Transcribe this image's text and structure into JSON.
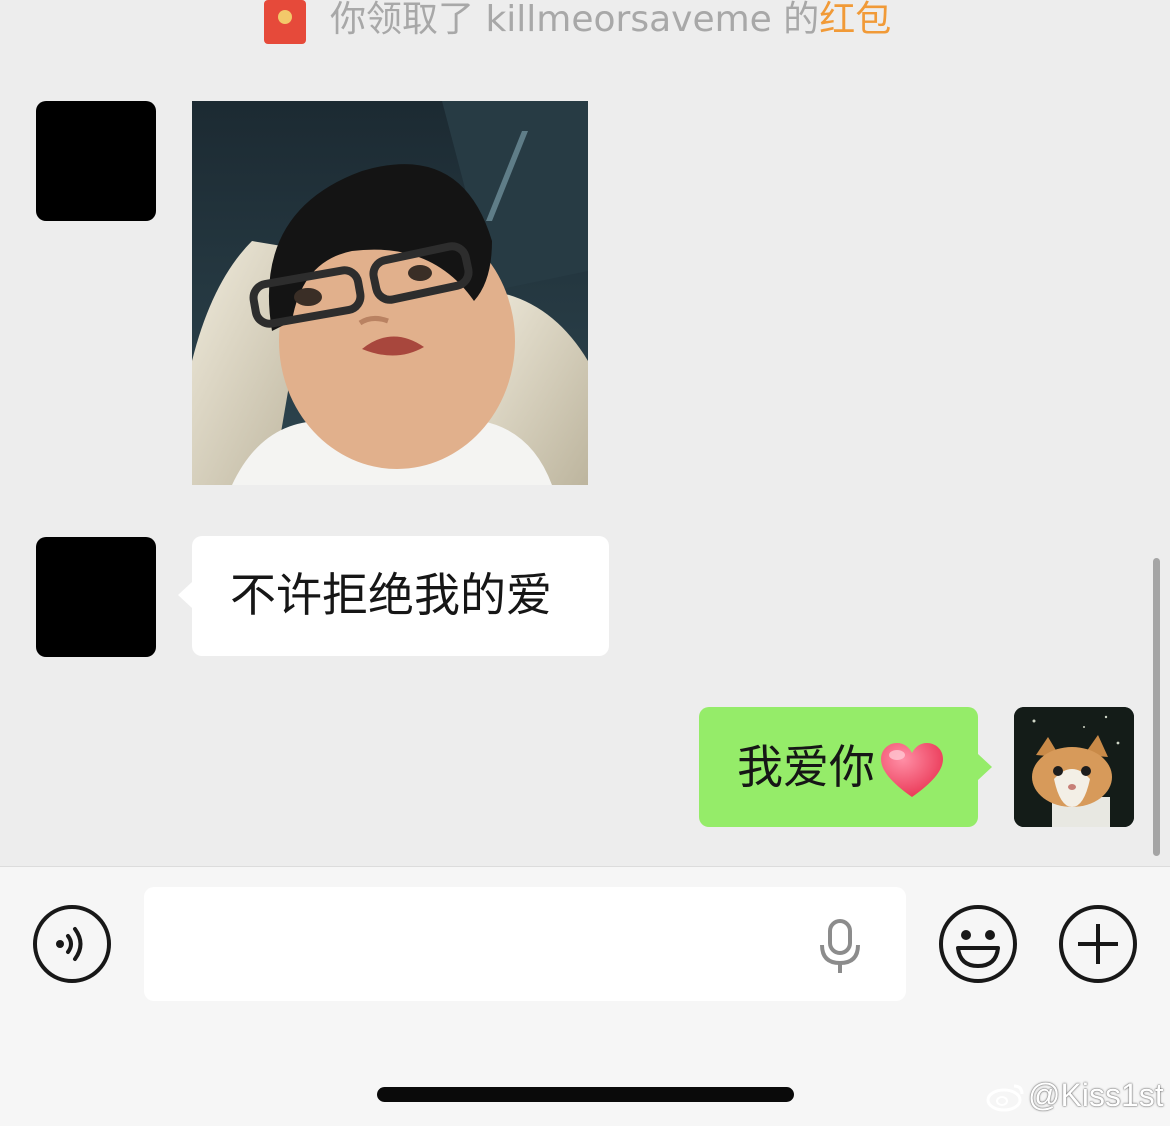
{
  "system_message": {
    "icon": "red-packet-icon",
    "text": "你领取了 killmeorsaveme 的",
    "link_text": "红包",
    "link_color": "#f19a37"
  },
  "messages": [
    {
      "side": "left",
      "type": "image",
      "avatar": "black-square",
      "image_desc_icon": "photo-boy-glasses"
    },
    {
      "side": "left",
      "type": "text",
      "avatar": "black-square",
      "text": "不许拒绝我的爱"
    },
    {
      "side": "right",
      "type": "text",
      "avatar": "cat-photo",
      "text": "我爱你",
      "emoji": "heart-icon"
    }
  ],
  "input_bar": {
    "voice_button_icon": "voice-icon",
    "text_value": "",
    "mic_icon": "microphone-icon",
    "emoji_button_icon": "smiley-icon",
    "more_button_icon": "plus-icon"
  },
  "watermark": {
    "text": "@Kiss1st",
    "icon": "weibo-icon"
  },
  "colors": {
    "chat_bg": "#ededed",
    "sent_bubble": "#95ec69",
    "received_bubble": "#ffffff",
    "input_bar_bg": "#f6f6f6"
  }
}
